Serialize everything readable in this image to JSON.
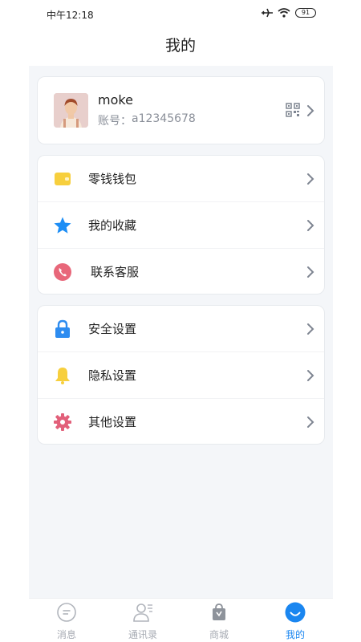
{
  "status": {
    "time": "中午12:18",
    "battery": "91"
  },
  "header": {
    "title": "我的"
  },
  "profile": {
    "name": "moke",
    "account_label": "账号：",
    "account_value": "a12345678"
  },
  "menu_group_1": [
    {
      "label": "零钱钱包",
      "icon": "wallet-icon",
      "color": "#f7cf3d"
    },
    {
      "label": "我的收藏",
      "icon": "star-icon",
      "color": "#1e8ef5"
    },
    {
      "label": "联系客服",
      "icon": "phone-icon",
      "color": "#e8677a"
    }
  ],
  "menu_group_2": [
    {
      "label": "安全设置",
      "icon": "lock-icon",
      "color": "#2d8cf0"
    },
    {
      "label": "隐私设置",
      "icon": "bell-icon",
      "color": "#f7cf3d"
    },
    {
      "label": "其他设置",
      "icon": "gear-icon",
      "color": "#e2607a"
    }
  ],
  "tabbar": {
    "tabs": [
      {
        "label": "消息",
        "icon": "message-icon"
      },
      {
        "label": "通讯录",
        "icon": "contacts-icon"
      },
      {
        "label": "商城",
        "icon": "shop-bag-icon"
      },
      {
        "label": "我的",
        "icon": "profile-smile-icon",
        "active": true
      }
    ]
  },
  "colors": {
    "accent": "#1a86f0",
    "background": "#f4f6f9",
    "card": "#ffffff"
  }
}
